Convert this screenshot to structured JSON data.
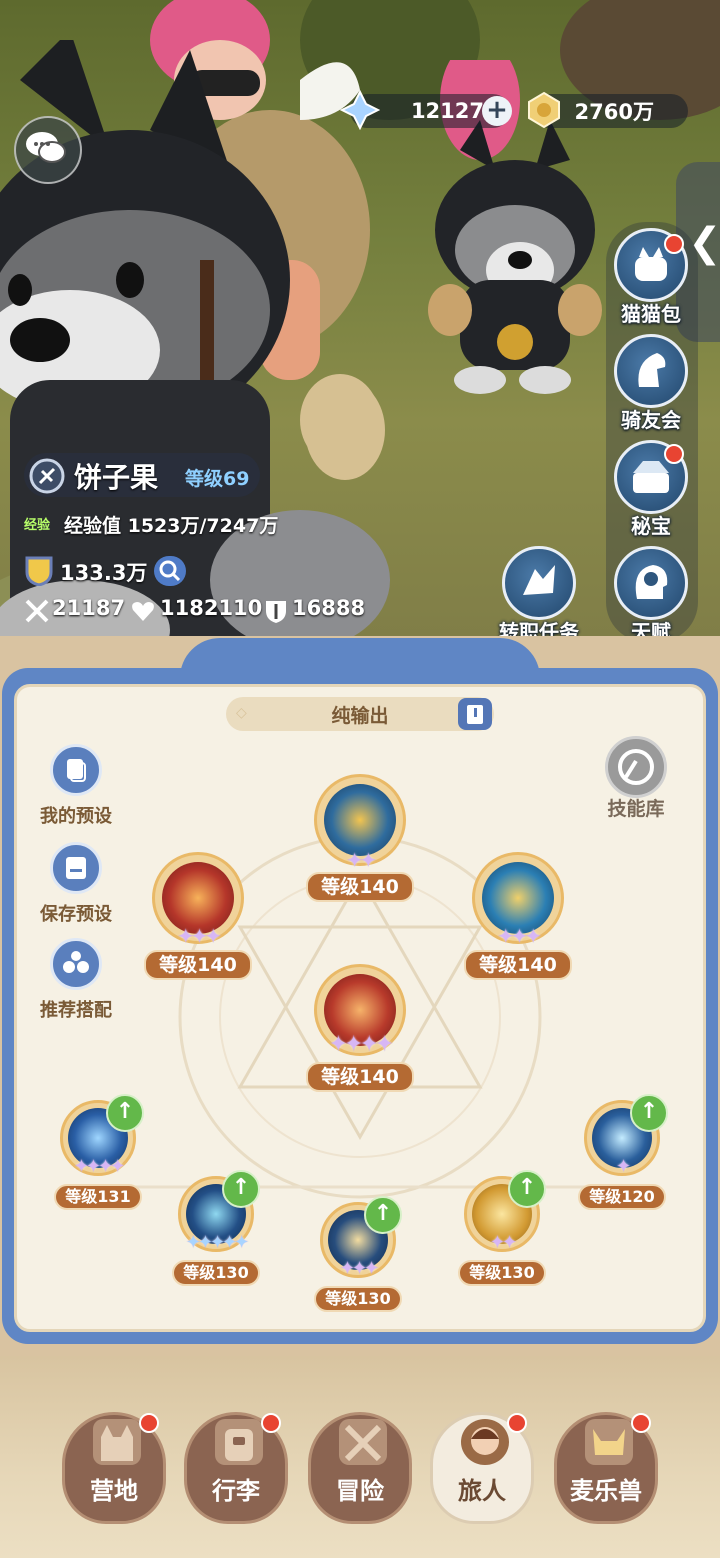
{
  "currency": {
    "crystal": "12127",
    "gold": "2760万"
  },
  "side_buttons": [
    {
      "label": "猫猫包",
      "icon": "cat-bag-icon",
      "badge": true
    },
    {
      "label": "骑友会",
      "icon": "horse-head-icon",
      "badge": false
    },
    {
      "label": "秘宝",
      "icon": "treasure-icon",
      "badge": true
    },
    {
      "label": "天赋",
      "icon": "brain-head-icon",
      "badge": false
    }
  ],
  "quest_button": {
    "label": "转职任务",
    "icon": "job-change-icon"
  },
  "player": {
    "name": "饼子果",
    "level": "等级69",
    "exp_tag": "经验",
    "exp_text": "经验值 1523万/7247万",
    "power": "133.3万",
    "attack": "21187",
    "hp": "1182110",
    "defense": "16888"
  },
  "panel": {
    "build_name": "纯输出",
    "left_actions": [
      {
        "label": "我的预设",
        "icon": "preset-icon"
      },
      {
        "label": "保存预设",
        "icon": "save-icon"
      },
      {
        "label": "推荐搭配",
        "icon": "recommend-icon"
      }
    ],
    "skill_library": "技能库",
    "skills": [
      {
        "level": "等级140",
        "stars": 2,
        "color": "#2f6c9e",
        "upgradable": false
      },
      {
        "level": "等级140",
        "stars": 3,
        "color": "#b5362a",
        "upgradable": false
      },
      {
        "level": "等级140",
        "stars": 3,
        "color": "#2b7fb4",
        "upgradable": false
      },
      {
        "level": "等级140",
        "stars": 4,
        "color": "#b83a2b",
        "upgradable": false
      },
      {
        "level": "等级131",
        "stars": 4,
        "color": "#2a5fa6",
        "upgradable": true
      },
      {
        "level": "等级130",
        "stars": 5,
        "color": "#234f86",
        "upgradable": true
      },
      {
        "level": "等级130",
        "stars": 3,
        "color": "#274d7d",
        "upgradable": true
      },
      {
        "level": "等级130",
        "stars": 2,
        "color": "#d29a32",
        "upgradable": true
      },
      {
        "level": "等级120",
        "stars": 1,
        "color": "#2a5f9c",
        "upgradable": true
      }
    ]
  },
  "nav": [
    {
      "label": "营地",
      "icon": "castle-icon",
      "badge": true,
      "active": false
    },
    {
      "label": "行李",
      "icon": "backpack-icon",
      "badge": true,
      "active": false
    },
    {
      "label": "冒险",
      "icon": "crossed-swords-icon",
      "badge": false,
      "active": false
    },
    {
      "label": "旅人",
      "icon": "traveler-avatar-icon",
      "badge": true,
      "active": true
    },
    {
      "label": "麦乐兽",
      "icon": "cat-face-icon",
      "badge": true,
      "active": false
    }
  ]
}
